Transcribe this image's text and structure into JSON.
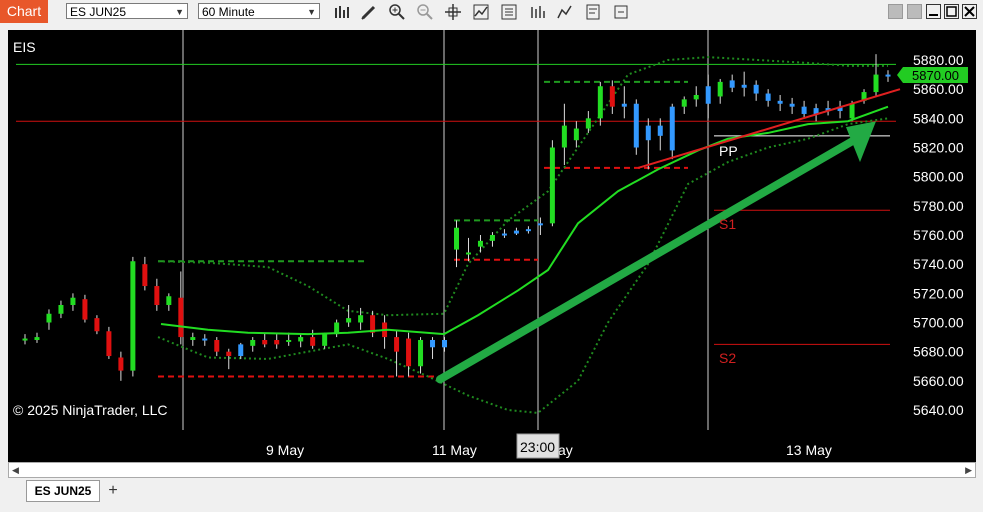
{
  "window": {
    "title_tab": "Chart",
    "instrument": "ES JUN25",
    "interval": "60 Minute",
    "bottom_tab": "ES JUN25",
    "add_tab_label": "+"
  },
  "toolbar": {
    "icons": [
      "bars-type-icon",
      "pencil-icon",
      "zoom-in-icon",
      "zoom-out-icon",
      "crosshair-icon",
      "indicators-icon",
      "strategies-icon",
      "data-box-icon",
      "drawing-tool-icon",
      "properties-icon",
      "more-icon"
    ]
  },
  "chart": {
    "symbol_label": "EIS",
    "copyright": "© 2025 NinjaTrader, LLC",
    "price_labels": [
      "5880.00",
      "5860.00",
      "5840.00",
      "5820.00",
      "5800.00",
      "5780.00",
      "5760.00",
      "5740.00",
      "5720.00",
      "5700.00",
      "5680.00",
      "5660.00",
      "5640.00"
    ],
    "current_price": "5870.00",
    "date_labels": [
      "9 May",
      "11 May",
      "13 May"
    ],
    "partial_date_label": "ay",
    "crosshair_time": "23:00",
    "pivot_labels": {
      "pp": "PP",
      "s1": "S1",
      "s2": "S2"
    },
    "colors": {
      "up": "#22dd22",
      "down": "#e01010",
      "neutral": "#3399ff",
      "ma": "#22dd22",
      "bollinger": "#1f8a1f",
      "arrow": "#22aa44",
      "trend": "#e02020",
      "price_badge": "#22cc22"
    }
  },
  "chart_data": {
    "type": "candlestick",
    "y_range": [
      5630,
      5895
    ],
    "price_line_green": 5877,
    "price_line_red": 5838,
    "pivots": {
      "PP": 5828,
      "S1": 5777,
      "S2": 5685
    },
    "candles": [
      {
        "o": 5689,
        "h": 5692,
        "l": 5685,
        "c": 5688,
        "d": "up"
      },
      {
        "o": 5688,
        "h": 5693,
        "l": 5686,
        "c": 5690,
        "d": "up"
      },
      {
        "o": 5700,
        "h": 5709,
        "l": 5695,
        "c": 5706,
        "d": "up"
      },
      {
        "o": 5706,
        "h": 5715,
        "l": 5703,
        "c": 5712,
        "d": "up"
      },
      {
        "o": 5712,
        "h": 5720,
        "l": 5708,
        "c": 5717,
        "d": "up"
      },
      {
        "o": 5716,
        "h": 5719,
        "l": 5700,
        "c": 5702,
        "d": "down"
      },
      {
        "o": 5703,
        "h": 5705,
        "l": 5692,
        "c": 5694,
        "d": "down"
      },
      {
        "o": 5694,
        "h": 5697,
        "l": 5675,
        "c": 5677,
        "d": "down"
      },
      {
        "o": 5676,
        "h": 5680,
        "l": 5660,
        "c": 5667,
        "d": "down"
      },
      {
        "o": 5667,
        "h": 5745,
        "l": 5663,
        "c": 5742,
        "d": "up"
      },
      {
        "o": 5740,
        "h": 5745,
        "l": 5722,
        "c": 5725,
        "d": "down"
      },
      {
        "o": 5725,
        "h": 5730,
        "l": 5708,
        "c": 5712,
        "d": "down"
      },
      {
        "o": 5712,
        "h": 5720,
        "l": 5708,
        "c": 5718,
        "d": "up"
      },
      {
        "o": 5717,
        "h": 5735,
        "l": 5685,
        "c": 5690,
        "d": "down"
      },
      {
        "o": 5690,
        "h": 5693,
        "l": 5684,
        "c": 5688,
        "d": "up"
      },
      {
        "o": 5689,
        "h": 5692,
        "l": 5684,
        "c": 5688,
        "d": "neutral"
      },
      {
        "o": 5688,
        "h": 5690,
        "l": 5677,
        "c": 5680,
        "d": "down"
      },
      {
        "o": 5680,
        "h": 5682,
        "l": 5668,
        "c": 5677,
        "d": "down"
      },
      {
        "o": 5677,
        "h": 5686,
        "l": 5675,
        "c": 5685,
        "d": "neutral"
      },
      {
        "o": 5684,
        "h": 5690,
        "l": 5680,
        "c": 5688,
        "d": "up"
      },
      {
        "o": 5688,
        "h": 5693,
        "l": 5683,
        "c": 5685,
        "d": "down"
      },
      {
        "o": 5685,
        "h": 5692,
        "l": 5682,
        "c": 5688,
        "d": "down"
      },
      {
        "o": 5688,
        "h": 5693,
        "l": 5684,
        "c": 5687,
        "d": "up"
      },
      {
        "o": 5687,
        "h": 5692,
        "l": 5683,
        "c": 5690,
        "d": "up"
      },
      {
        "o": 5690,
        "h": 5695,
        "l": 5682,
        "c": 5684,
        "d": "down"
      },
      {
        "o": 5684,
        "h": 5693,
        "l": 5682,
        "c": 5692,
        "d": "up"
      },
      {
        "o": 5692,
        "h": 5702,
        "l": 5690,
        "c": 5700,
        "d": "up"
      },
      {
        "o": 5700,
        "h": 5712,
        "l": 5697,
        "c": 5703,
        "d": "up"
      },
      {
        "o": 5700,
        "h": 5710,
        "l": 5695,
        "c": 5705,
        "d": "up"
      },
      {
        "o": 5705,
        "h": 5708,
        "l": 5690,
        "c": 5693,
        "d": "down"
      },
      {
        "o": 5700,
        "h": 5705,
        "l": 5682,
        "c": 5690,
        "d": "down"
      },
      {
        "o": 5690,
        "h": 5695,
        "l": 5663,
        "c": 5680,
        "d": "down"
      },
      {
        "o": 5689,
        "h": 5693,
        "l": 5663,
        "c": 5670,
        "d": "down"
      },
      {
        "o": 5670,
        "h": 5690,
        "l": 5665,
        "c": 5688,
        "d": "up"
      },
      {
        "o": 5688,
        "h": 5690,
        "l": 5675,
        "c": 5683,
        "d": "neutral"
      },
      {
        "o": 5683,
        "h": 5690,
        "l": 5680,
        "c": 5688,
        "d": "neutral"
      },
      {
        "o": 5750,
        "h": 5770,
        "l": 5738,
        "c": 5765,
        "d": "up"
      },
      {
        "o": 5748,
        "h": 5758,
        "l": 5742,
        "c": 5748,
        "d": "up"
      },
      {
        "o": 5752,
        "h": 5760,
        "l": 5748,
        "c": 5756,
        "d": "up"
      },
      {
        "o": 5756,
        "h": 5762,
        "l": 5752,
        "c": 5760,
        "d": "up"
      },
      {
        "o": 5760,
        "h": 5764,
        "l": 5758,
        "c": 5761,
        "d": "neutral"
      },
      {
        "o": 5761,
        "h": 5765,
        "l": 5760,
        "c": 5763,
        "d": "neutral"
      },
      {
        "o": 5763,
        "h": 5766,
        "l": 5761,
        "c": 5764,
        "d": "neutral"
      },
      {
        "o": 5768,
        "h": 5772,
        "l": 5760,
        "c": 5768,
        "d": "neutral"
      },
      {
        "o": 5768,
        "h": 5825,
        "l": 5766,
        "c": 5820,
        "d": "up"
      },
      {
        "o": 5820,
        "h": 5850,
        "l": 5808,
        "c": 5835,
        "d": "up"
      },
      {
        "o": 5825,
        "h": 5838,
        "l": 5820,
        "c": 5833,
        "d": "up"
      },
      {
        "o": 5833,
        "h": 5845,
        "l": 5830,
        "c": 5840,
        "d": "up"
      },
      {
        "o": 5840,
        "h": 5865,
        "l": 5835,
        "c": 5862,
        "d": "up"
      },
      {
        "o": 5862,
        "h": 5866,
        "l": 5843,
        "c": 5848,
        "d": "down"
      },
      {
        "o": 5848,
        "h": 5862,
        "l": 5840,
        "c": 5850,
        "d": "neutral"
      },
      {
        "o": 5850,
        "h": 5853,
        "l": 5815,
        "c": 5820,
        "d": "neutral"
      },
      {
        "o": 5825,
        "h": 5840,
        "l": 5805,
        "c": 5835,
        "d": "neutral"
      },
      {
        "o": 5835,
        "h": 5840,
        "l": 5818,
        "c": 5828,
        "d": "neutral"
      },
      {
        "o": 5818,
        "h": 5850,
        "l": 5812,
        "c": 5848,
        "d": "neutral"
      },
      {
        "o": 5848,
        "h": 5855,
        "l": 5843,
        "c": 5853,
        "d": "up"
      },
      {
        "o": 5853,
        "h": 5862,
        "l": 5848,
        "c": 5856,
        "d": "up"
      },
      {
        "o": 5862,
        "h": 5870,
        "l": 5840,
        "c": 5850,
        "d": "neutral"
      },
      {
        "o": 5855,
        "h": 5867,
        "l": 5850,
        "c": 5865,
        "d": "up"
      },
      {
        "o": 5866,
        "h": 5870,
        "l": 5858,
        "c": 5861,
        "d": "neutral"
      },
      {
        "o": 5861,
        "h": 5872,
        "l": 5855,
        "c": 5863,
        "d": "neutral"
      },
      {
        "o": 5863,
        "h": 5866,
        "l": 5852,
        "c": 5857,
        "d": "neutral"
      },
      {
        "o": 5857,
        "h": 5860,
        "l": 5848,
        "c": 5852,
        "d": "neutral"
      },
      {
        "o": 5852,
        "h": 5856,
        "l": 5845,
        "c": 5850,
        "d": "neutral"
      },
      {
        "o": 5850,
        "h": 5854,
        "l": 5843,
        "c": 5848,
        "d": "neutral"
      },
      {
        "o": 5848,
        "h": 5852,
        "l": 5840,
        "c": 5843,
        "d": "neutral"
      },
      {
        "o": 5843,
        "h": 5850,
        "l": 5838,
        "c": 5847,
        "d": "neutral"
      },
      {
        "o": 5847,
        "h": 5852,
        "l": 5842,
        "c": 5845,
        "d": "neutral"
      },
      {
        "o": 5845,
        "h": 5852,
        "l": 5840,
        "c": 5848,
        "d": "neutral"
      },
      {
        "o": 5840,
        "h": 5852,
        "l": 5838,
        "c": 5850,
        "d": "up"
      },
      {
        "o": 5852,
        "h": 5860,
        "l": 5850,
        "c": 5858,
        "d": "up"
      },
      {
        "o": 5858,
        "h": 5884,
        "l": 5855,
        "c": 5870,
        "d": "up"
      },
      {
        "o": 5870,
        "h": 5873,
        "l": 5865,
        "c": 5870,
        "d": "neutral"
      }
    ],
    "ma": [
      5698,
      5697,
      5696,
      5695,
      5694,
      5694,
      5693,
      5693,
      5693,
      5692,
      5692,
      5692,
      5692,
      5693,
      5694,
      5695,
      5694,
      5693,
      5690,
      5695,
      5703,
      5713,
      5722,
      5731,
      5740,
      5750,
      5760,
      5775,
      5790,
      5800,
      5808,
      5818,
      5825,
      5830,
      5835,
      5838,
      5840,
      5840,
      5842,
      5843,
      5844,
      5846,
      5848,
      5850
    ]
  }
}
